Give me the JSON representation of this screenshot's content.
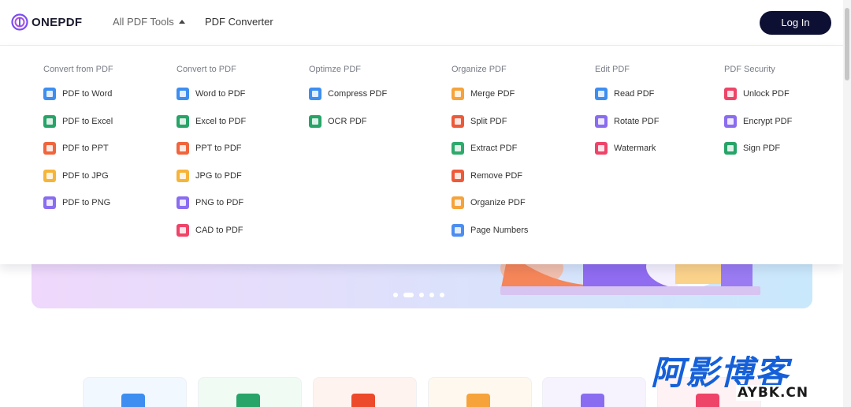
{
  "header": {
    "brand": "ONEPDF",
    "nav": {
      "tools_label": "All PDF Tools",
      "converter_label": "PDF Converter"
    },
    "login_label": "Log In"
  },
  "menu": {
    "columns": [
      {
        "title": "Convert from PDF",
        "items": [
          {
            "label": "PDF to Word",
            "icon": "word-file-icon",
            "color": "#3d8ef0"
          },
          {
            "label": "PDF to Excel",
            "icon": "excel-file-icon",
            "color": "#27a468"
          },
          {
            "label": "PDF to PPT",
            "icon": "ppt-file-icon",
            "color": "#f0653d"
          },
          {
            "label": "PDF to JPG",
            "icon": "jpg-file-icon",
            "color": "#f5b53a"
          },
          {
            "label": "PDF to PNG",
            "icon": "png-file-icon",
            "color": "#8a6cf0"
          }
        ]
      },
      {
        "title": "Convert to PDF",
        "items": [
          {
            "label": "Word to PDF",
            "icon": "word-file-icon",
            "color": "#3d8ef0"
          },
          {
            "label": "Excel to PDF",
            "icon": "excel-file-icon",
            "color": "#27a468"
          },
          {
            "label": "PPT to PDF",
            "icon": "ppt-file-icon",
            "color": "#f0653d"
          },
          {
            "label": "JPG to PDF",
            "icon": "jpg-file-icon",
            "color": "#f5b53a"
          },
          {
            "label": "PNG to PDF",
            "icon": "png-file-icon",
            "color": "#8a6cf0"
          },
          {
            "label": "CAD to PDF",
            "icon": "cad-file-icon",
            "color": "#ee4469"
          }
        ]
      },
      {
        "title": "Optimze PDF",
        "items": [
          {
            "label": "Compress PDF",
            "icon": "compress-icon",
            "color": "#3d8ef0"
          },
          {
            "label": "OCR PDF",
            "icon": "ocr-icon",
            "color": "#27a468"
          }
        ]
      },
      {
        "title": "Organize PDF",
        "items": [
          {
            "label": "Merge PDF",
            "icon": "merge-icon",
            "color": "#f5a33a"
          },
          {
            "label": "Split PDF",
            "icon": "split-icon",
            "color": "#ec5a3a"
          },
          {
            "label": "Extract PDF",
            "icon": "extract-icon",
            "color": "#2eaa6c"
          },
          {
            "label": "Remove PDF",
            "icon": "remove-icon",
            "color": "#ec5a3a"
          },
          {
            "label": "Organize PDF",
            "icon": "organize-icon",
            "color": "#f5a33a"
          },
          {
            "label": "Page Numbers",
            "icon": "page-numbers-icon",
            "color": "#4c8ef0"
          }
        ]
      },
      {
        "title": "Edit PDF",
        "items": [
          {
            "label": "Read PDF",
            "icon": "read-icon",
            "color": "#3d8ef0"
          },
          {
            "label": "Rotate PDF",
            "icon": "rotate-icon",
            "color": "#8a6cf0"
          },
          {
            "label": "Watermark",
            "icon": "watermark-icon",
            "color": "#ee4469"
          }
        ]
      },
      {
        "title": "PDF Security",
        "items": [
          {
            "label": "Unlock PDF",
            "icon": "unlock-icon",
            "color": "#ee4469"
          },
          {
            "label": "Encrypt PDF",
            "icon": "encrypt-icon",
            "color": "#8a6cf0"
          },
          {
            "label": "Sign PDF",
            "icon": "sign-icon",
            "color": "#27a468"
          }
        ]
      }
    ]
  },
  "banner": {
    "slide_count": 5,
    "active_slide": 2
  },
  "cards": [
    {
      "icon": "word-file-icon",
      "color": "#3d8ef0",
      "bg": "#f2f8ff"
    },
    {
      "icon": "excel-file-icon",
      "color": "#27a468",
      "bg": "#f0fbf4"
    },
    {
      "icon": "ppt-file-icon",
      "color": "#ec4a2a",
      "bg": "#fff3f0"
    },
    {
      "icon": "jpg-file-icon",
      "color": "#f5a33a",
      "bg": "#fff8ee"
    },
    {
      "icon": "png-file-icon",
      "color": "#8a6cf0",
      "bg": "#f6f3ff"
    },
    {
      "icon": "cad-file-icon",
      "color": "#ee4469",
      "bg": "#fff2f5"
    }
  ],
  "watermark": {
    "cn": "阿影博客",
    "en": "AYBK.CN"
  }
}
